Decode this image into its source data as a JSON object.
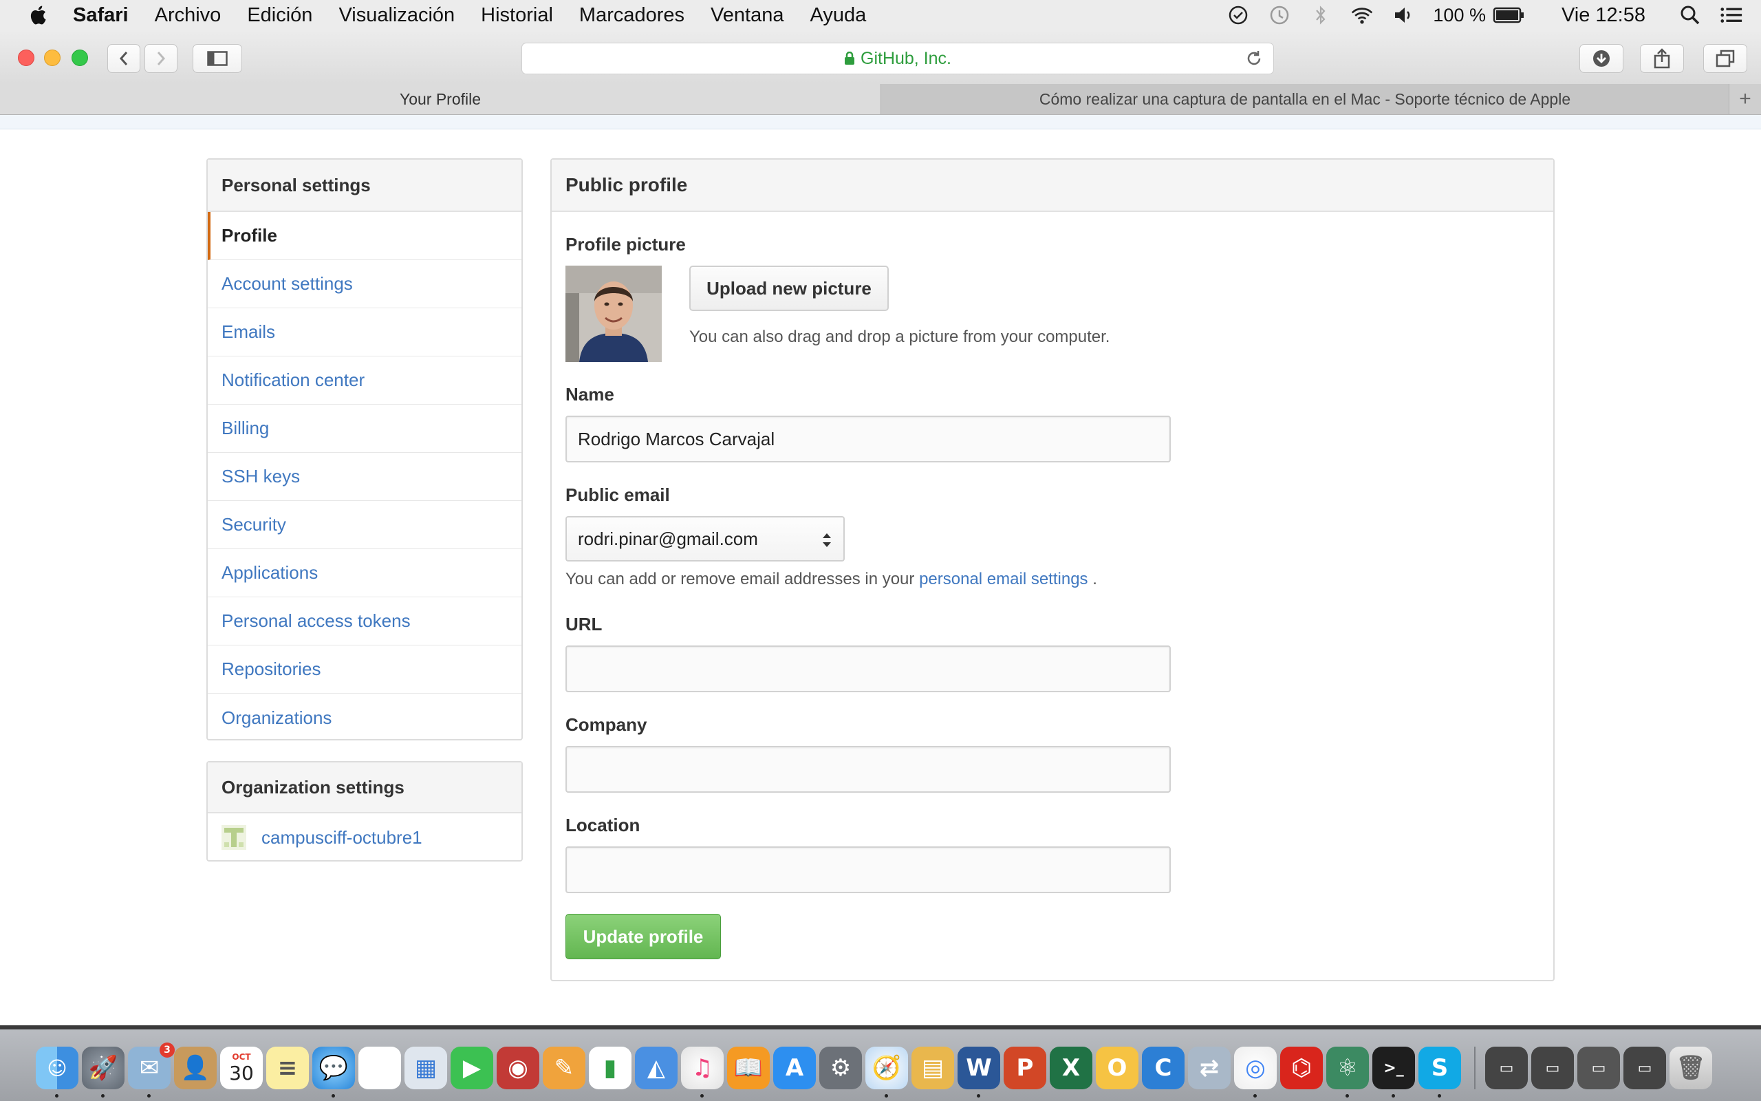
{
  "menubar": {
    "app": "Safari",
    "items": [
      "Archivo",
      "Edición",
      "Visualización",
      "Historial",
      "Marcadores",
      "Ventana",
      "Ayuda"
    ],
    "battery": "100 %",
    "clock": "Vie 12:58"
  },
  "browser": {
    "address": "GitHub, Inc.",
    "tabs": [
      {
        "label": "Your Profile"
      },
      {
        "label": "Cómo realizar una captura de pantalla en el Mac - Soporte técnico de Apple"
      }
    ]
  },
  "sidebar": {
    "personal_title": "Personal settings",
    "items": [
      {
        "label": "Profile"
      },
      {
        "label": "Account settings"
      },
      {
        "label": "Emails"
      },
      {
        "label": "Notification center"
      },
      {
        "label": "Billing"
      },
      {
        "label": "SSH keys"
      },
      {
        "label": "Security"
      },
      {
        "label": "Applications"
      },
      {
        "label": "Personal access tokens"
      },
      {
        "label": "Repositories"
      },
      {
        "label": "Organizations"
      }
    ],
    "org_title": "Organization settings",
    "org_name": "campusciff-octubre1"
  },
  "profile": {
    "title": "Public profile",
    "picture_label": "Profile picture",
    "upload_button": "Upload new picture",
    "drag_note": "You can also drag and drop a picture from your computer.",
    "name_label": "Name",
    "name_value": "Rodrigo Marcos Carvajal",
    "email_label": "Public email",
    "email_value": "rodri.pinar@gmail.com",
    "email_note_prefix": "You can add or remove email addresses in your",
    "email_note_link": "personal email settings",
    "email_note_suffix": ".",
    "url_label": "URL",
    "url_value": "",
    "company_label": "Company",
    "company_value": "",
    "location_label": "Location",
    "location_value": "",
    "update_button": "Update profile"
  },
  "dock": {
    "calendar_month": "OCT",
    "calendar_day": "30",
    "mail_badge": "3"
  }
}
